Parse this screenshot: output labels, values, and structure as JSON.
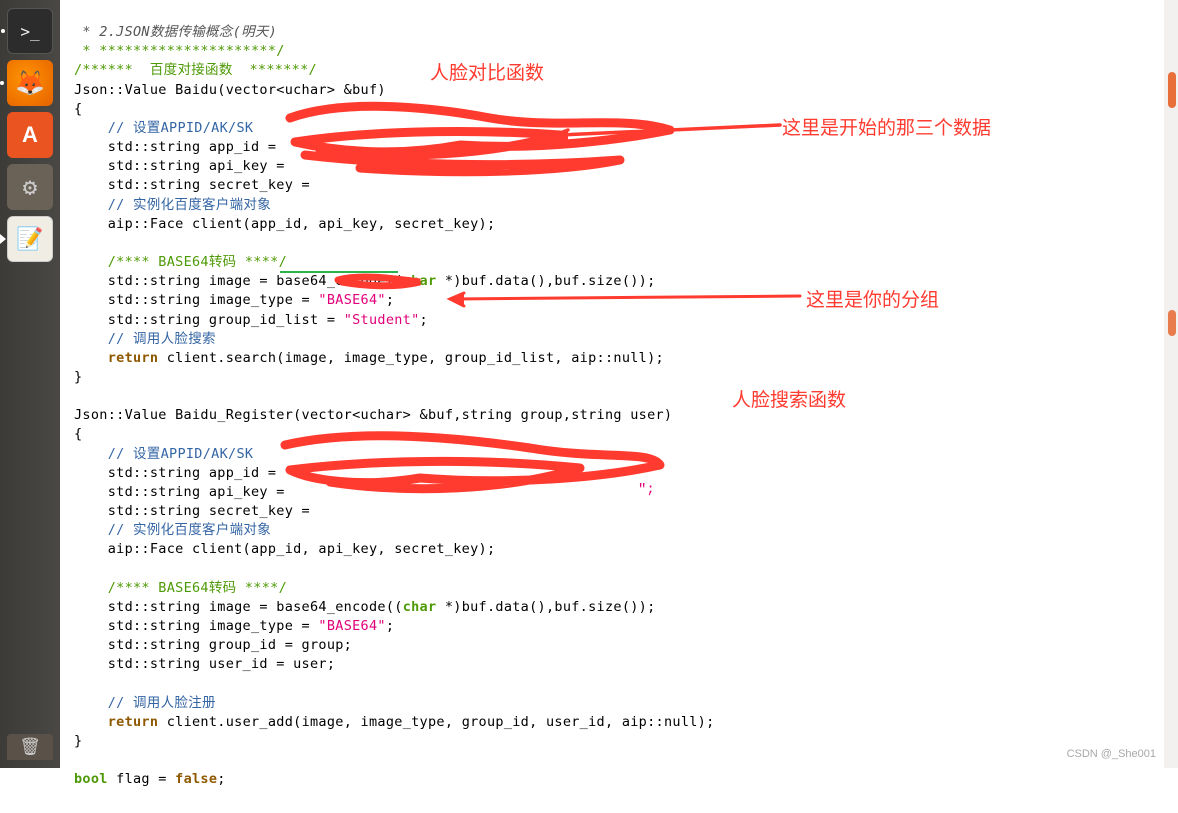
{
  "launcher": {
    "items": [
      {
        "name": "terminal",
        "indicator": true
      },
      {
        "name": "firefox",
        "indicator": true
      },
      {
        "name": "software-center",
        "indicator": false
      },
      {
        "name": "system-settings",
        "indicator": false
      },
      {
        "name": "text-editor",
        "indicator": true,
        "active": true
      }
    ],
    "bottom": {
      "name": "trash"
    }
  },
  "annotations": {
    "a1": "人脸对比函数",
    "a2": "这里是开始的那三个数据",
    "a3": "这里是你的分组",
    "a4": "人脸搜索函数"
  },
  "code": {
    "l1": " * 2.JSON数据传输概念(明天)",
    "l2": " * *********************/",
    "l3a": "/******  百度对接函数  *******/",
    "l4a": "Json::Value Baidu(vector<uchar> &buf)",
    "l5": "{",
    "l6": "    ",
    "l6c": "// 设置APPID/AK/SK",
    "l7": "    std::string app_id = ",
    "l8": "    std::string api_key = ",
    "l9": "    std::string secret_key = ",
    "l10": "    ",
    "l10c": "// 实例化百度客户端对象",
    "l11": "    aip::Face client(app_id, api_key, secret_key);",
    "l12": "",
    "l13": "    ",
    "l13c": "/**** BASE64转码 ****/",
    "l14a": "    std::string image = base64_encode((",
    "l14b": "char",
    "l14c": " *)buf.data(),buf.size());",
    "l15a": "    std::string image_type = ",
    "l15b": "\"BASE64\"",
    "l15c": ";",
    "l16a": "    std::string group_id_list = ",
    "l16b": "\"Student\"",
    "l16c": ";",
    "l17": "    ",
    "l17c": "// 调用人脸搜索",
    "l18a": "    ",
    "l18b": "return",
    "l18c": " client.search(image, image_type, group_id_list, aip::null);",
    "l19": "}",
    "l20": "",
    "l21": "Json::Value Baidu_Register(vector<uchar> &buf,string group,string user)",
    "l22": "{",
    "l23": "    ",
    "l23c": "// 设置APPID/AK/SK",
    "l24": "    std::string app_id = ",
    "l25": "    std::string api_key = ",
    "l26": "    std::string secret_key = ",
    "l27": "    ",
    "l27c": "// 实例化百度客户端对象",
    "l28": "    aip::Face client(app_id, api_key, secret_key);",
    "l29": "",
    "l30": "    ",
    "l30c": "/**** BASE64转码 ****/",
    "l31a": "    std::string image = base64_encode((",
    "l31b": "char",
    "l31c": " *)buf.data(),buf.size());",
    "l32a": "    std::string image_type = ",
    "l32b": "\"BASE64\"",
    "l32c": ";",
    "l33": "    std::string group_id = group;",
    "l34": "    std::string user_id = user;",
    "l35": "",
    "l36": "    ",
    "l36c": "// 调用人脸注册",
    "l37a": "    ",
    "l37b": "return",
    "l37c": " client.user_add(image, image_type, group_id, user_id, aip::null);",
    "l38": "}",
    "l39": "",
    "l40a": "bool",
    "l40b": " flag = ",
    "l40c": "false",
    "l40d": ";"
  },
  "watermark": "CSDN @_She001",
  "colors": {
    "annotation": "#ff3b30",
    "comment_blue": "#3465a4",
    "comment_green": "#4e9a06",
    "keyword_brown": "#8f5902",
    "string_pink": "#e0007a",
    "scroll_orange": "#e86f3a"
  }
}
